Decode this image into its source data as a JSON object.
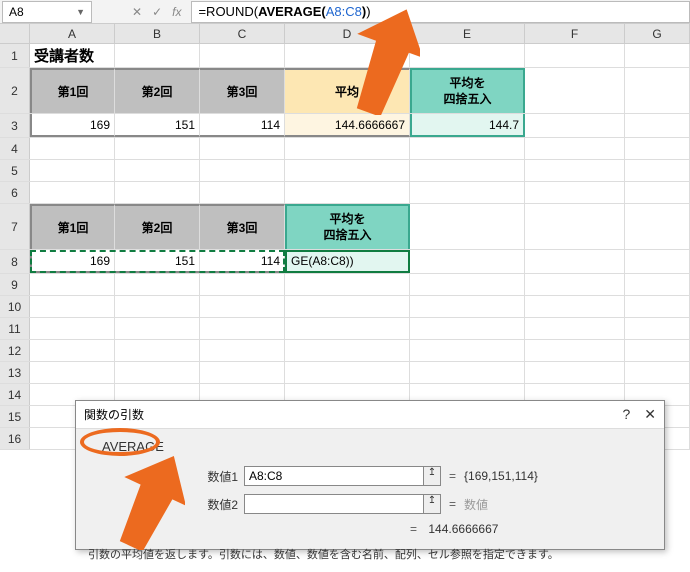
{
  "namebox": "A8",
  "formula": {
    "prefix": "=ROUND(",
    "fn": "AVERAGE",
    "open": "(",
    "range": "A8:C8",
    "close": ")",
    "suffix": ")"
  },
  "columns": [
    "A",
    "B",
    "C",
    "D",
    "E",
    "F",
    "G"
  ],
  "title": "受講者数",
  "headers1": {
    "c1": "第1回",
    "c2": "第2回",
    "c3": "第3回",
    "avg": "平均",
    "round": "平均を\n四捨五入"
  },
  "row3": {
    "v1": "169",
    "v2": "151",
    "v3": "114",
    "avg": "144.6666667",
    "round": "144.7"
  },
  "headers2": {
    "c1": "第1回",
    "c2": "第2回",
    "c3": "第3回",
    "round": "平均を\n四捨五入"
  },
  "row8": {
    "v1": "169",
    "v2": "151",
    "v3": "114",
    "cell": "GE(A8:C8))"
  },
  "dialog": {
    "title": "関数の引数",
    "fn": "AVERAGE",
    "arg1_label": "数値1",
    "arg1_value": "A8:C8",
    "arg1_result": "{169,151,114}",
    "arg2_label": "数値2",
    "arg2_placeholder": "数値",
    "result": "144.6666667",
    "desc": "引数の平均値を返します。引数には、数値、数値を含む名前、配列、セル参照を指定できます。"
  }
}
